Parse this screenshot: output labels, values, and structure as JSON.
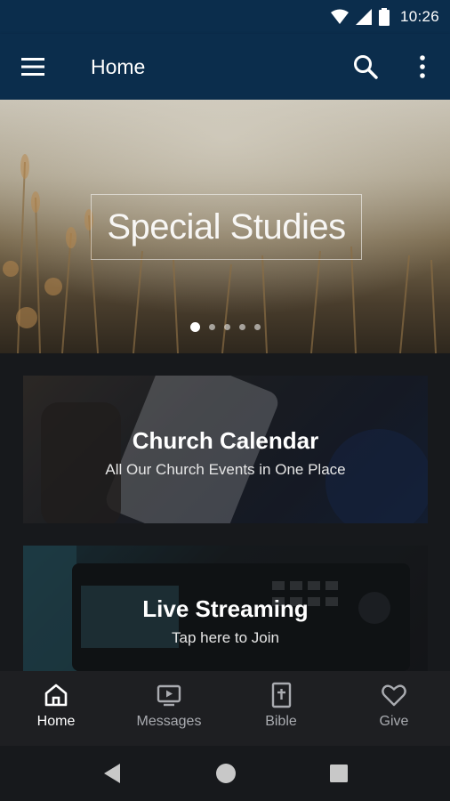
{
  "status_bar": {
    "time": "10:26"
  },
  "app_bar": {
    "title": "Home"
  },
  "hero": {
    "title": "Special Studies",
    "slide_count": 5,
    "active_slide": 1
  },
  "cards": [
    {
      "title": "Church Calendar",
      "subtitle": "All Our Church Events in One Place"
    },
    {
      "title": "Live Streaming",
      "subtitle": "Tap here to Join"
    }
  ],
  "bottom_nav": {
    "items": [
      {
        "label": "Home",
        "icon": "home-icon",
        "active": true
      },
      {
        "label": "Messages",
        "icon": "video-icon",
        "active": false
      },
      {
        "label": "Bible",
        "icon": "bible-icon",
        "active": false
      },
      {
        "label": "Give",
        "icon": "heart-icon",
        "active": false
      }
    ]
  },
  "colors": {
    "app_bar": "#0b2d4c",
    "background": "#17191c",
    "nav_background": "#1e1f22",
    "nav_inactive": "#a9abb0"
  }
}
